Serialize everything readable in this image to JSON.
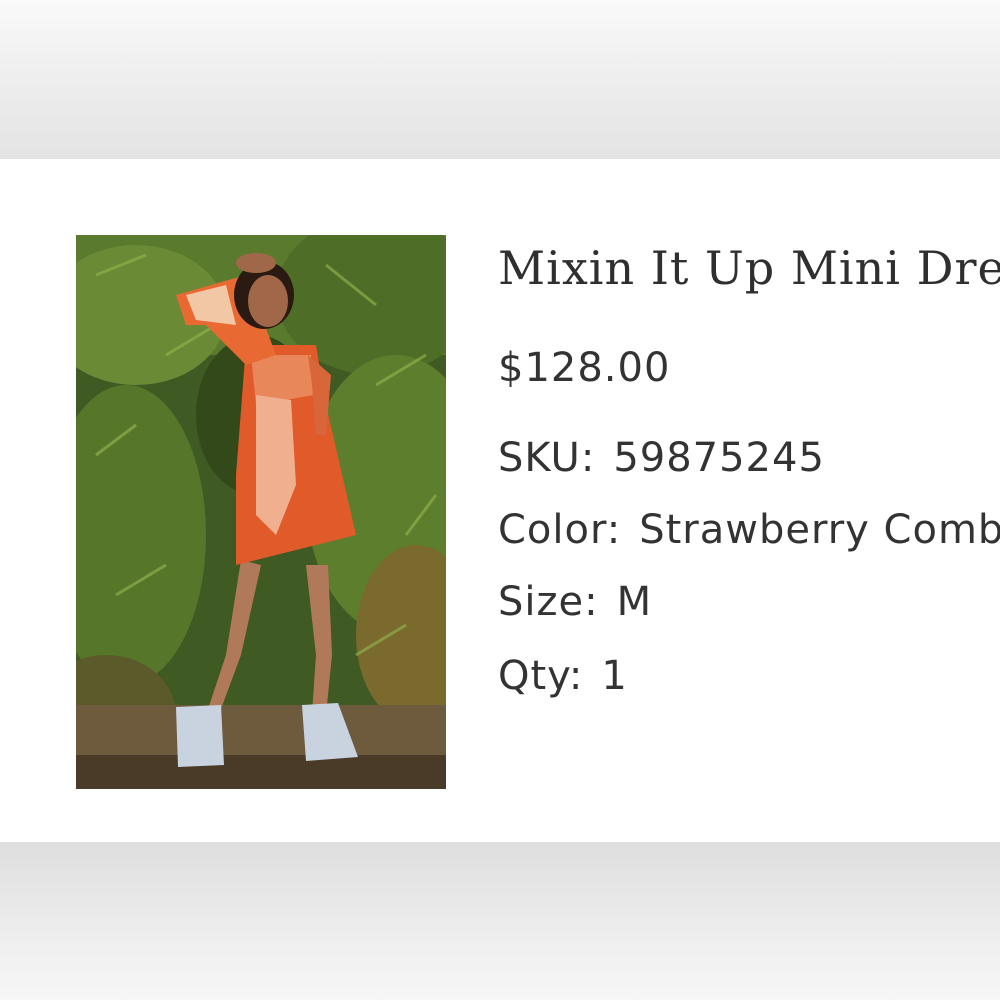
{
  "product": {
    "title": "Mixin It Up Mini Dress",
    "price": "$128.00",
    "sku": {
      "label": "SKU:",
      "value": "59875245"
    },
    "color": {
      "label": "Color:",
      "value": "Strawberry Combo"
    },
    "size": {
      "label": "Size:",
      "value": "M"
    },
    "qty": {
      "label": "Qty:",
      "value": "1"
    }
  },
  "colors": {
    "text": "#333333",
    "card_background": "#ffffff",
    "page_background": "#ececec"
  }
}
